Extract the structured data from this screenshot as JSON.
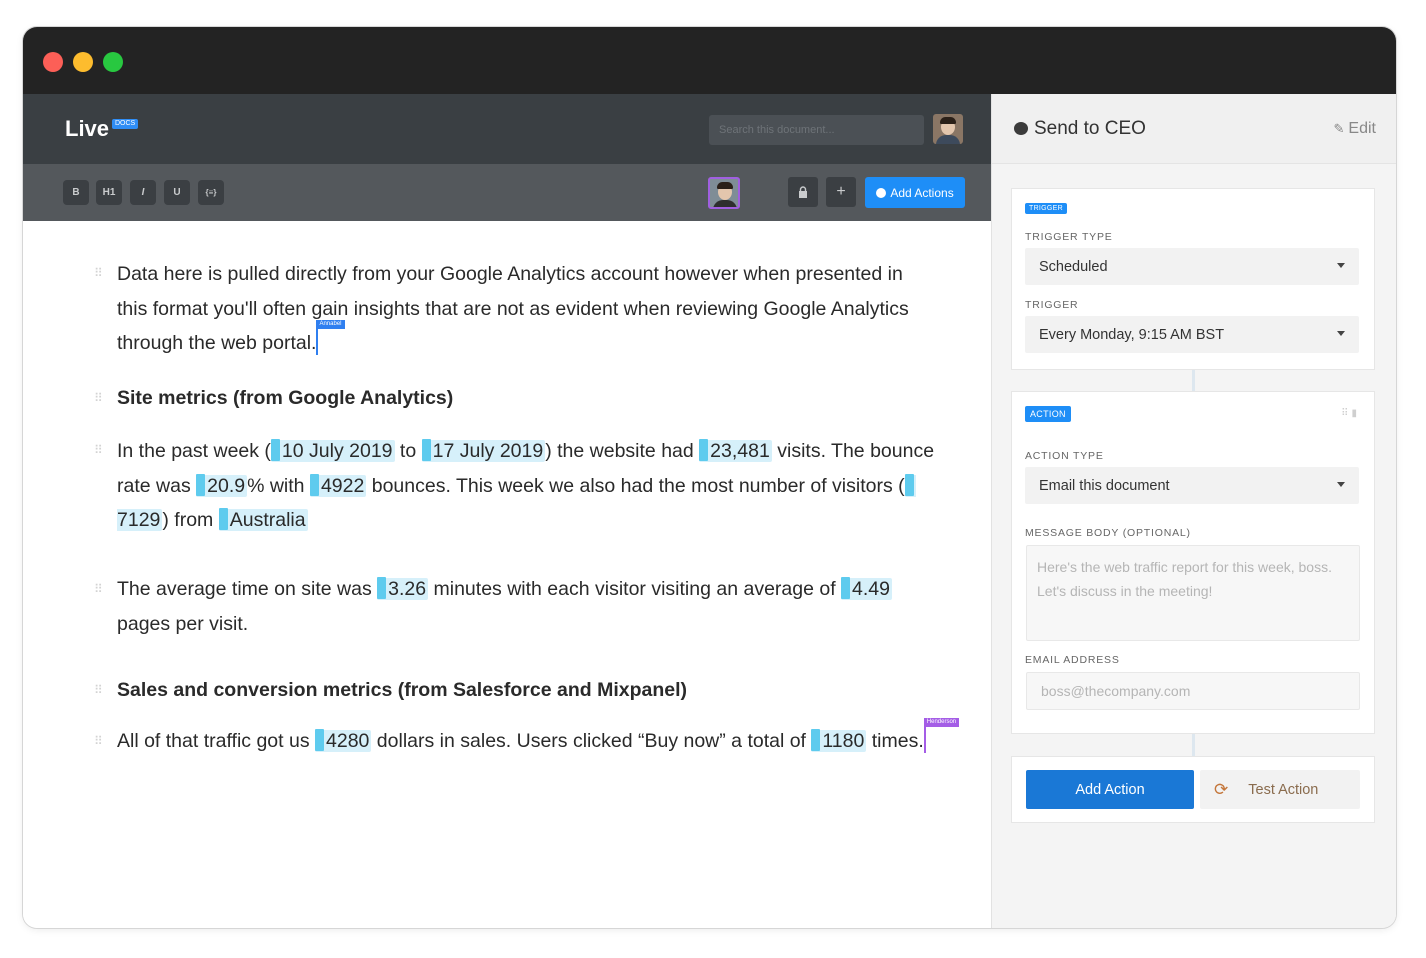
{
  "app": {
    "logo_text": "Live",
    "logo_badge": "DOCS",
    "search_placeholder": "Search this document..."
  },
  "toolbar": {
    "format_buttons": [
      "B",
      "H1",
      "I",
      "U",
      "{≡}"
    ],
    "add_actions_label": "Add Actions"
  },
  "document": {
    "intro": "Data here is pulled directly from your Google Analytics account however when presented in this format you'll often gain insights that are not as evident when reviewing Google Analytics through the web portal.",
    "cursor_1_label": "Annabel",
    "heading_1": "Site metrics (from Google Analytics)",
    "p2": {
      "t1": "In the past week (",
      "start_date": "10 July 2019",
      "t2": " to ",
      "end_date": "17 July 2019",
      "t3": ") the website had ",
      "visits": "23,481",
      "t4": " visits. The bounce rate was ",
      "bounce_rate": "20.9",
      "t5": "% with ",
      "bounces": "4922",
      "t6": " bounces. This week we also had the most number of visitors (",
      "top_visitors": "7129",
      "t7": ") from ",
      "top_country": "Australia"
    },
    "p3": {
      "t1": "The average time on site was ",
      "avg_time": "3.26",
      "t2": " minutes with each visitor visiting an average of ",
      "pages_per_visit": "4.49",
      "t3": " pages per visit."
    },
    "heading_2": "Sales and conversion metrics (from Salesforce and Mixpanel)",
    "p4": {
      "t1": "All of that traffic got us ",
      "sales": "4280",
      "t2": " dollars in sales. Users clicked “Buy now” a total of ",
      "buy_clicks": "1180",
      "t3": " times."
    },
    "cursor_2_label": "Henderson"
  },
  "panel": {
    "title": "Send to CEO",
    "edit_label": "Edit",
    "trigger": {
      "tag": "TRIGGER",
      "type_label": "TRIGGER TYPE",
      "type_value": "Scheduled",
      "trigger_label": "TRIGGER",
      "trigger_value": "Every Monday, 9:15 AM BST"
    },
    "action": {
      "tag": "ACTION",
      "type_label": "ACTION TYPE",
      "type_value": "Email this document",
      "message_label": "MESSAGE BODY (OPTIONAL)",
      "message_placeholder": "Here's the web traffic report for this week, boss. Let's discuss in the meeting!",
      "email_label": "EMAIL ADDRESS",
      "email_placeholder": "boss@thecompany.com"
    },
    "add_action_label": "Add Action",
    "test_action_label": "Test Action"
  },
  "colors": {
    "accent": "#1e8ef7",
    "token_bg": "#d6f0fa",
    "token_marker": "#5ecbee",
    "cursor_blue": "#2f7ff0",
    "cursor_purple": "#a45de6"
  }
}
